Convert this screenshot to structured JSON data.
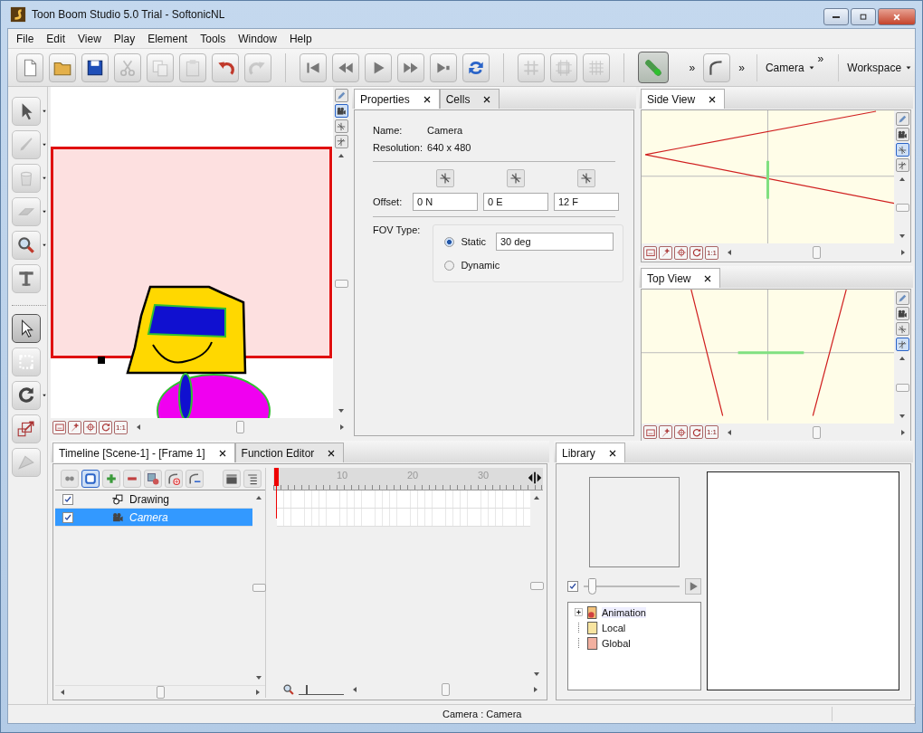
{
  "window": {
    "title": "Toon Boom Studio 5.0 Trial - SoftonicNL"
  },
  "menu": [
    "File",
    "Edit",
    "View",
    "Play",
    "Element",
    "Tools",
    "Window",
    "Help"
  ],
  "toolbar": {
    "items": [
      {
        "kind": "button",
        "disabled": false,
        "pressed": false
      },
      {
        "kind": "button",
        "disabled": false,
        "pressed": false
      },
      {
        "kind": "button",
        "disabled": false,
        "pressed": false
      },
      {
        "kind": "button",
        "disabled": true,
        "pressed": false
      },
      {
        "kind": "button",
        "disabled": true,
        "pressed": false
      },
      {
        "kind": "button",
        "disabled": true,
        "pressed": false
      },
      {
        "kind": "button",
        "disabled": false,
        "pressed": false
      },
      {
        "kind": "button",
        "disabled": true,
        "pressed": false
      },
      {
        "kind": "separator"
      },
      {
        "kind": "button",
        "disabled": false,
        "pressed": false
      },
      {
        "kind": "button",
        "disabled": false,
        "pressed": false
      },
      {
        "kind": "button",
        "disabled": false,
        "pressed": false
      },
      {
        "kind": "button",
        "disabled": false,
        "pressed": false
      },
      {
        "kind": "button",
        "disabled": false,
        "pressed": false
      },
      {
        "kind": "button",
        "disabled": false,
        "pressed": false
      },
      {
        "kind": "separator"
      },
      {
        "kind": "button",
        "disabled": true,
        "pressed": false
      },
      {
        "kind": "button",
        "disabled": true,
        "pressed": false
      },
      {
        "kind": "button",
        "disabled": true,
        "pressed": false
      },
      {
        "kind": "separator"
      },
      {
        "kind": "button",
        "disabled": false,
        "pressed": true
      },
      {
        "kind": "overflow",
        "label": "»"
      },
      {
        "kind": "button",
        "disabled": false,
        "pressed": false
      },
      {
        "kind": "overflow",
        "label": "»"
      },
      {
        "kind": "menu",
        "label": "Camera",
        "overflow": "»"
      },
      {
        "kind": "menu",
        "label": "Workspace"
      }
    ]
  },
  "toolbox": {
    "items": [
      {
        "kind": "tool",
        "has_menu": true,
        "selected": false,
        "disabled": false
      },
      {
        "kind": "tool",
        "has_menu": true,
        "selected": false,
        "disabled": true
      },
      {
        "kind": "tool",
        "has_menu": true,
        "selected": false,
        "disabled": true
      },
      {
        "kind": "tool",
        "has_menu": true,
        "selected": false,
        "disabled": true
      },
      {
        "kind": "tool",
        "has_menu": true,
        "selected": false,
        "disabled": false
      },
      {
        "kind": "tool",
        "has_menu": false,
        "selected": false,
        "disabled": false
      },
      {
        "kind": "separator"
      },
      {
        "kind": "tool",
        "has_menu": false,
        "selected": true,
        "disabled": false
      },
      {
        "kind": "tool",
        "has_menu": false,
        "selected": false,
        "disabled": false
      },
      {
        "kind": "tool",
        "has_menu": true,
        "selected": false,
        "disabled": false
      },
      {
        "kind": "tool",
        "has_menu": false,
        "selected": false,
        "disabled": false
      },
      {
        "kind": "tool",
        "has_menu": false,
        "selected": false,
        "disabled": true
      }
    ]
  },
  "canvas": {
    "side_buttons": [
      {
        "selected": false
      },
      {
        "selected": true
      },
      {
        "selected": false
      },
      {
        "selected": false
      }
    ],
    "zoom_label": "1:1"
  },
  "properties": {
    "tabs": [
      {
        "label": "Properties",
        "selected": true
      },
      {
        "label": "Cells",
        "selected": false
      }
    ],
    "name": {
      "label": "Name:",
      "value": "Camera"
    },
    "resolution": {
      "label": "Resolution:",
      "value": "640 x 480"
    },
    "offset": {
      "label": "Offset:",
      "values": [
        "0 N",
        "0 E",
        "12 F"
      ]
    },
    "fov": {
      "label": "FOV Type:",
      "options": [
        {
          "label": "Static",
          "selected": true,
          "value": "30 deg"
        },
        {
          "label": "Dynamic",
          "selected": false
        }
      ]
    }
  },
  "views": [
    {
      "kind": "side",
      "tab": "Side View",
      "side_buttons": [
        {
          "selected": false
        },
        {
          "selected": false
        },
        {
          "selected": true
        },
        {
          "selected": false
        }
      ],
      "zoom_label": "1:1"
    },
    {
      "kind": "top",
      "tab": "Top View",
      "side_buttons": [
        {
          "selected": false
        },
        {
          "selected": false
        },
        {
          "selected": false
        },
        {
          "selected": true
        }
      ],
      "zoom_label": "1:1"
    }
  ],
  "timeline": {
    "tabs": [
      {
        "label": "Timeline [Scene-1] - [Frame 1]",
        "selected": true
      },
      {
        "label": "Function Editor",
        "selected": false
      }
    ],
    "tools": [
      {
        "pressed": false
      },
      {
        "pressed": true
      },
      {
        "pressed": false
      },
      {
        "pressed": false
      },
      {
        "pressed": false
      },
      {
        "pressed": false
      },
      {
        "pressed": false
      }
    ],
    "tools_right": [
      {
        "pressed": false
      },
      {
        "pressed": false
      }
    ],
    "layers": [
      {
        "name": "Drawing",
        "kind": "drawing",
        "checked": true,
        "selected": false
      },
      {
        "name": "Camera",
        "kind": "camera",
        "checked": true,
        "selected": true
      }
    ],
    "ruler": [
      "10",
      "20",
      "30"
    ],
    "zoom_slider": {
      "level": 0.15
    }
  },
  "library": {
    "tabs": [
      {
        "label": "Library",
        "selected": true
      }
    ],
    "preview": {
      "checked": true
    },
    "slider": {
      "level": 0.05
    },
    "tree": [
      {
        "label": "Animation",
        "kind": "animation",
        "expanded": false,
        "selected": true
      },
      {
        "label": "Local",
        "kind": "local",
        "selected": false
      },
      {
        "label": "Global",
        "kind": "global",
        "selected": false
      }
    ]
  },
  "status_bar": {
    "text": "Camera : Camera"
  }
}
